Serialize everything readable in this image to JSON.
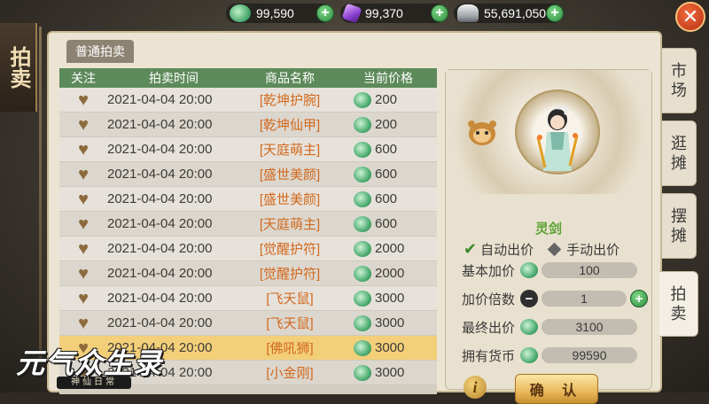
{
  "currencies": [
    {
      "name": "jade-coin",
      "value": "99,590"
    },
    {
      "name": "purple-gem",
      "value": "99,370"
    },
    {
      "name": "silver-ingot",
      "value": "55,691,050"
    }
  ],
  "title": "拍卖",
  "tab_normal": "普通拍卖",
  "columns": {
    "follow": "关注",
    "time": "拍卖时间",
    "item": "商品名称",
    "price": "当前价格"
  },
  "rows": [
    {
      "time": "2021-04-04 20:00",
      "item": "[乾坤护腕]",
      "price": "200"
    },
    {
      "time": "2021-04-04 20:00",
      "item": "[乾坤仙甲]",
      "price": "200"
    },
    {
      "time": "2021-04-04 20:00",
      "item": "[天庭萌主]",
      "price": "600"
    },
    {
      "time": "2021-04-04 20:00",
      "item": "[盛世美颜]",
      "price": "600"
    },
    {
      "time": "2021-04-04 20:00",
      "item": "[盛世美颜]",
      "price": "600"
    },
    {
      "time": "2021-04-04 20:00",
      "item": "[天庭萌主]",
      "price": "600"
    },
    {
      "time": "2021-04-04 20:00",
      "item": "[觉醒护符]",
      "price": "2000"
    },
    {
      "time": "2021-04-04 20:00",
      "item": "[觉醒护符]",
      "price": "2000"
    },
    {
      "time": "2021-04-04 20:00",
      "item": "[飞天鼠]",
      "price": "3000"
    },
    {
      "time": "2021-04-04 20:00",
      "item": "[飞天鼠]",
      "price": "3000"
    },
    {
      "time": "2021-04-04 20:00",
      "item": "[佛吼狮]",
      "price": "3000"
    },
    {
      "time": "2021-04-04 20:00",
      "item": "[小金刚]",
      "price": "3000"
    }
  ],
  "detail": {
    "char_name": "灵剑",
    "auto_bid": "自动出价",
    "manual_bid": "手动出价",
    "base_inc_label": "基本加价",
    "base_inc_value": "100",
    "multiplier_label": "加价倍数",
    "multiplier_value": "1",
    "final_bid_label": "最终出价",
    "final_bid_value": "3100",
    "owned_label": "拥有货币",
    "owned_value": "99590",
    "confirm": "确 认"
  },
  "side_tabs": [
    "市场",
    "逛摊",
    "摆摊",
    "拍卖"
  ],
  "logo": {
    "title": "元气众生录",
    "subtitle": "神仙日常"
  }
}
